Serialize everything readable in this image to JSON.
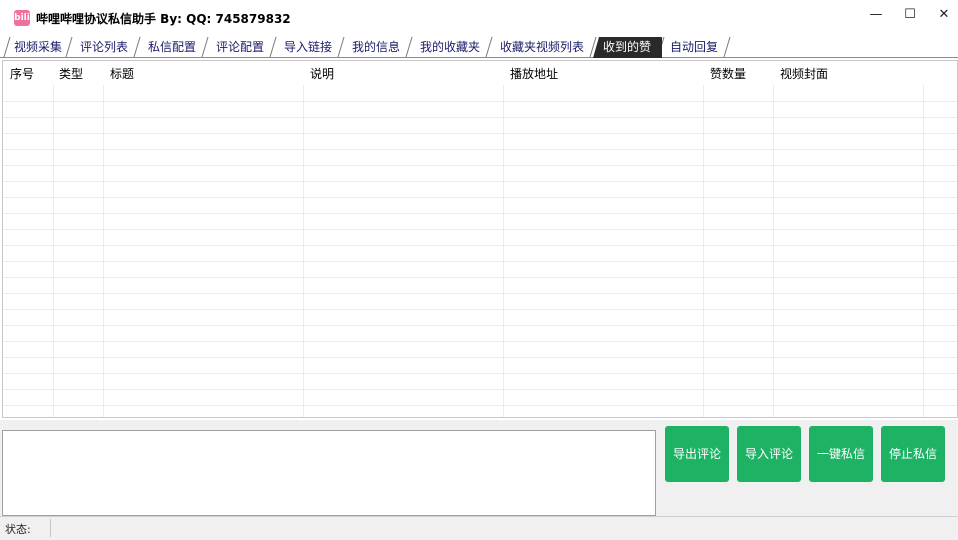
{
  "app": {
    "title": "哔哩哔哩协议私信助手 By:  QQ:  745879832",
    "icon_text": "bili"
  },
  "window_controls": {
    "minimize": "—",
    "maximize": "☐",
    "close": "✕"
  },
  "tabs": [
    {
      "label": "视频采集",
      "active": false
    },
    {
      "label": "评论列表",
      "active": false
    },
    {
      "label": "私信配置",
      "active": false
    },
    {
      "label": "评论配置",
      "active": false
    },
    {
      "label": "导入链接",
      "active": false
    },
    {
      "label": "我的信息",
      "active": false
    },
    {
      "label": "我的收藏夹",
      "active": false
    },
    {
      "label": "收藏夹视频列表",
      "active": false
    },
    {
      "label": "收到的赞",
      "active": true
    },
    {
      "label": "自动回复",
      "active": false
    }
  ],
  "table": {
    "columns": [
      "序号",
      "类型",
      "标题",
      "说明",
      "播放地址",
      "赞数量",
      "视频封面"
    ],
    "rows": []
  },
  "buttons": {
    "export_comments": "导出评论",
    "import_comments": "导入评论",
    "one_click_message": "一键私信",
    "stop_message": "停止私信"
  },
  "log": {
    "value": ""
  },
  "status": {
    "label": "状态:",
    "value": ""
  },
  "colors": {
    "button_green": "#1db264",
    "active_tab": "#2a2a2a",
    "tab_text": "#1a1a6a"
  }
}
